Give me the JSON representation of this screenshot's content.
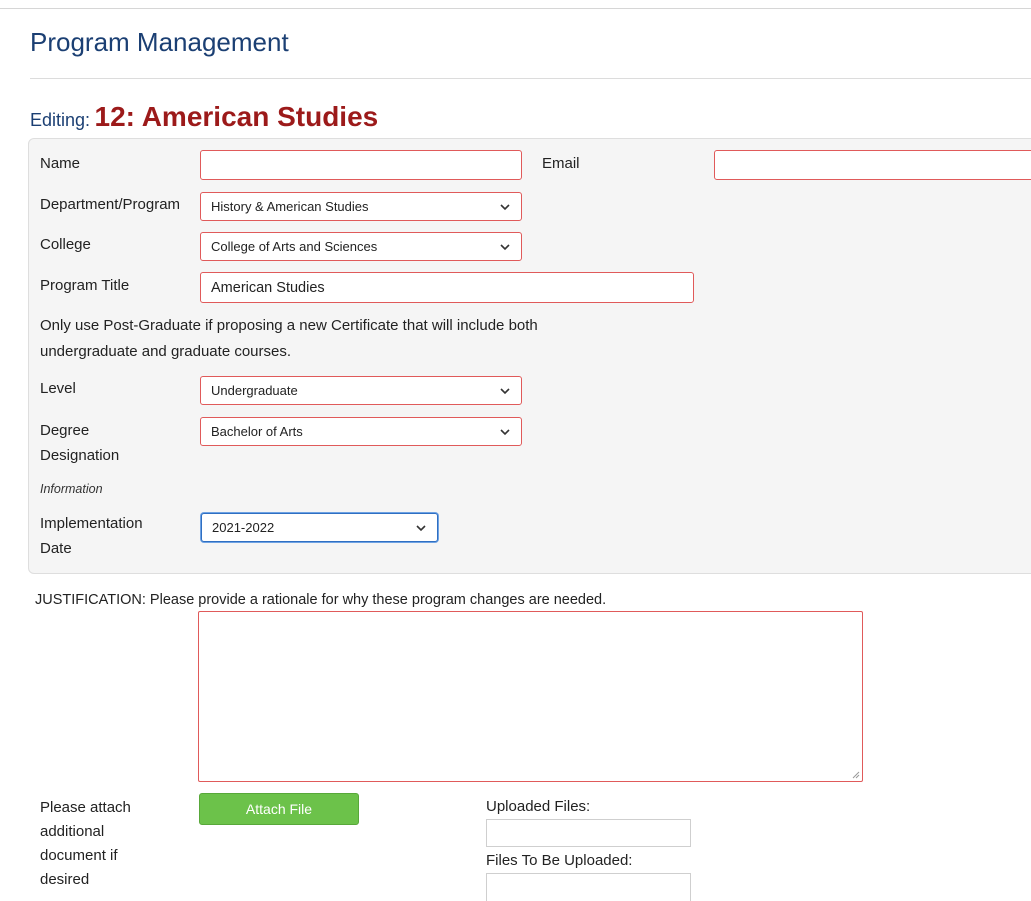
{
  "page": {
    "title": "Program Management",
    "editing_prefix": "Editing:",
    "editing_name": "12: American Studies"
  },
  "form": {
    "name_label": "Name",
    "name_value": "",
    "email_label": "Email",
    "email_value": "",
    "department_label": "Department/Program",
    "department_value": "History & American Studies",
    "college_label": "College",
    "college_value": "College of Arts and Sciences",
    "program_title_label": "Program Title",
    "program_title_value": "American Studies",
    "note_line1": "Only use Post-Graduate if proposing a new Certificate that will include both",
    "note_line2": "undergraduate and graduate courses.",
    "level_label": "Level",
    "level_value": "Undergraduate",
    "degree_label_line1": "Degree",
    "degree_label_line2": "Designation",
    "degree_value": "Bachelor of Arts",
    "information_label": "Information",
    "implementation_label_line1": "Implementation",
    "implementation_label_line2": "Date",
    "implementation_value": "2021-2022"
  },
  "justification": {
    "label": "JUSTIFICATION: Please provide a rationale for why these program changes are needed.",
    "value": ""
  },
  "attachments": {
    "prompt_lines": [
      "Please attach",
      "additional",
      "document if",
      "desired"
    ],
    "attach_button_label": "Attach File",
    "uploaded_label": "Uploaded Files:",
    "to_upload_label": "Files To Be Uploaded:"
  },
  "colors": {
    "title_blue": "#1b3f73",
    "record_red": "#9c1a1a",
    "invalid_border": "#e05a5a",
    "focus_border": "#2f6fc2",
    "button_green": "#6cc24a"
  }
}
